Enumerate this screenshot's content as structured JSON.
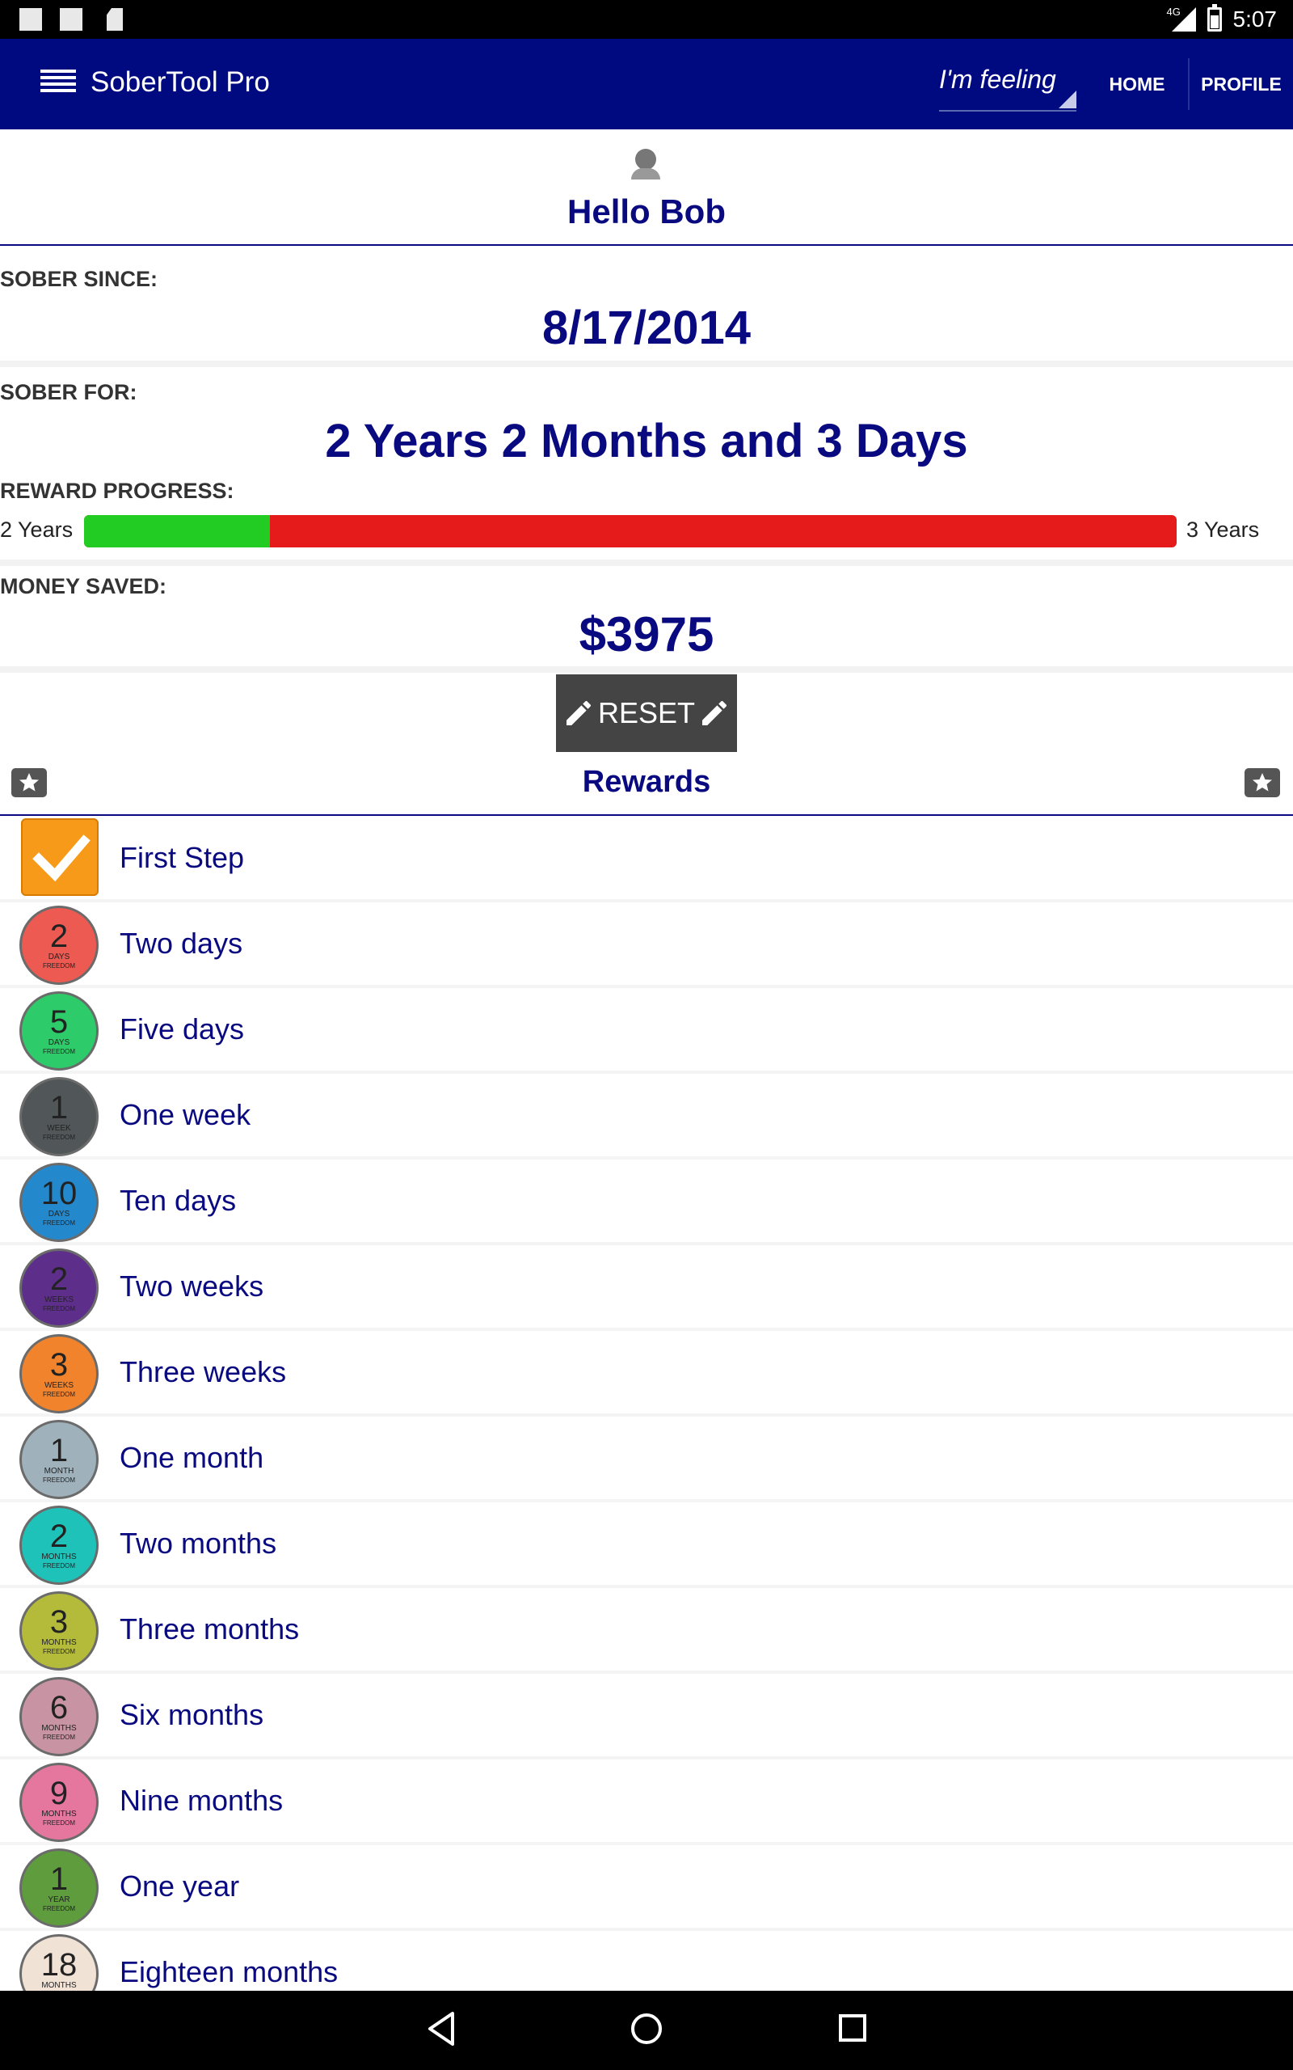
{
  "status_bar": {
    "network": "4G",
    "time": "5:07"
  },
  "app_bar": {
    "title": "SoberTool Pro",
    "feeling_placeholder": "I'm feeling",
    "home_label": "HOME",
    "profile_label": "PROFILE"
  },
  "greeting": "Hello Bob",
  "sober_since": {
    "label": "SOBER SINCE:",
    "value": "8/17/2014"
  },
  "sober_for": {
    "label": "SOBER FOR:",
    "value": "2 Years 2 Months and 3 Days"
  },
  "reward_progress": {
    "label": "REWARD PROGRESS:",
    "start_label": "2 Years",
    "end_label": "3 Years",
    "fraction": 0.17,
    "fill_color": "#22cc22",
    "remaining_color": "#e51a1a"
  },
  "money_saved": {
    "label": "MONEY SAVED:",
    "value": "$3975"
  },
  "reset_label": "RESET",
  "rewards": {
    "title": "Rewards",
    "items": [
      {
        "label": "First Step",
        "badge": "checkbox",
        "color": "#f79a1a"
      },
      {
        "label": "Two days",
        "num": "2",
        "unit": "DAYS",
        "color": "#ec5a52"
      },
      {
        "label": "Five days",
        "num": "5",
        "unit": "DAYS",
        "color": "#2ecb6a"
      },
      {
        "label": "One week",
        "num": "1",
        "unit": "WEEK",
        "color": "#515658"
      },
      {
        "label": "Ten days",
        "num": "10",
        "unit": "DAYS",
        "color": "#2489cc"
      },
      {
        "label": "Two weeks",
        "num": "2",
        "unit": "WEEKS",
        "color": "#5e2f8a"
      },
      {
        "label": "Three weeks",
        "num": "3",
        "unit": "WEEKS",
        "color": "#f0832c"
      },
      {
        "label": "One month",
        "num": "1",
        "unit": "MONTH",
        "color": "#9fb1bb"
      },
      {
        "label": "Two months",
        "num": "2",
        "unit": "MONTHS",
        "color": "#1fc2b8"
      },
      {
        "label": "Three months",
        "num": "3",
        "unit": "MONTHS",
        "color": "#b4bb3a"
      },
      {
        "label": "Six months",
        "num": "6",
        "unit": "MONTHS",
        "color": "#c894a4"
      },
      {
        "label": "Nine months",
        "num": "9",
        "unit": "MONTHS",
        "color": "#e5779e"
      },
      {
        "label": "One year",
        "num": "1",
        "unit": "YEAR",
        "color": "#5e9c3e"
      },
      {
        "label": "Eighteen months",
        "num": "18",
        "unit": "MONTHS",
        "color": "#f1e2d6"
      }
    ],
    "badge_footer": "FREEDOM"
  }
}
